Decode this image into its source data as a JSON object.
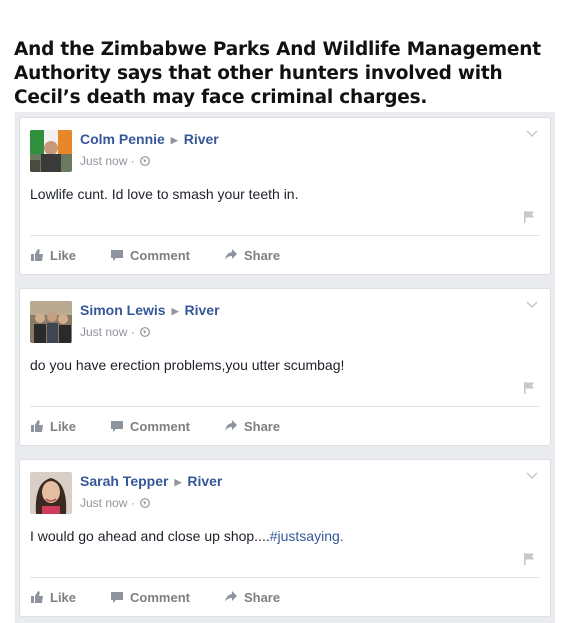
{
  "headline": "And the Zimbabwe Parks And Wildlife Management Authority says that other hunters involved with Cecil’s death may face criminal charges.",
  "colors": {
    "link": "#365899",
    "meta": "#90949c",
    "action": "#7f7f7f",
    "feed_bg": "#e9ebee"
  },
  "actions": {
    "like": "Like",
    "comment": "Comment",
    "share": "Share"
  },
  "posts": [
    {
      "author": "Colm Pennie",
      "target": "River",
      "time": "Just now ·",
      "text": "Lowlife cunt. Id love to smash your teeth in.",
      "hashtag": ""
    },
    {
      "author": "Simon Lewis",
      "target": "River",
      "time": "Just now ·",
      "text": "do you have erection problems,you utter scumbag!",
      "hashtag": ""
    },
    {
      "author": "Sarah Tepper",
      "target": "River",
      "time": "Just now ·",
      "text": "I would go ahead and close up shop....",
      "hashtag": "#justsaying."
    }
  ]
}
